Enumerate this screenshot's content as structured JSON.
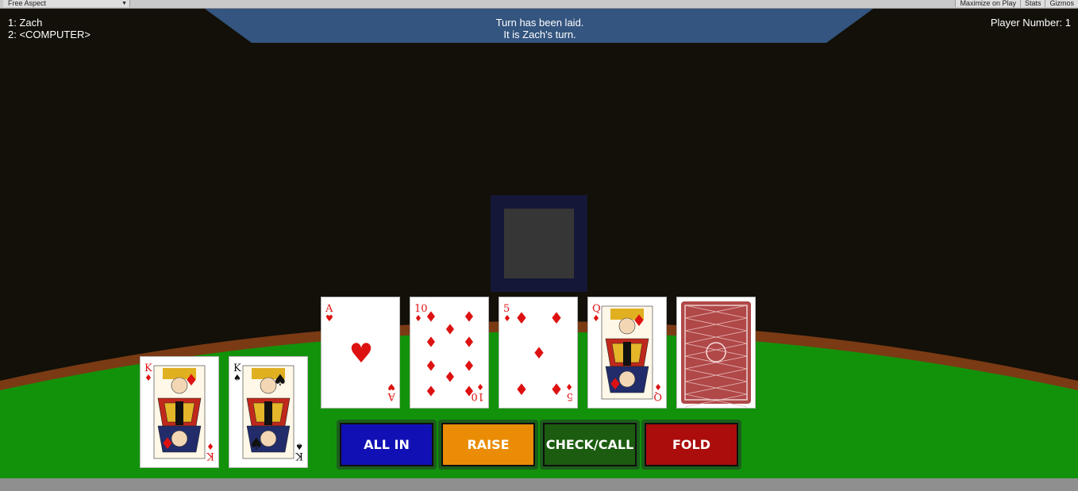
{
  "editor": {
    "aspect_label": "Free Aspect",
    "maximize_label": "Maximize on Play",
    "stats_label": "Stats",
    "gizmos_label": "Gizmos"
  },
  "status": {
    "line1": "Turn has been laid.",
    "line2": "It is Zach's turn."
  },
  "players": [
    "1: Zach",
    "2: <COMPUTER>"
  ],
  "player_number": "Player Number: 1",
  "hand": [
    {
      "rank": "K",
      "suit": "diamonds",
      "suit_symbol": "♦",
      "color": "#dd1111"
    },
    {
      "rank": "K",
      "suit": "spades",
      "suit_symbol": "♠",
      "color": "#111111"
    }
  ],
  "community": [
    {
      "rank": "A",
      "suit": "hearts",
      "suit_symbol": "♥",
      "color": "#dd1111"
    },
    {
      "rank": "10",
      "suit": "diamonds",
      "suit_symbol": "♦",
      "color": "#dd1111"
    },
    {
      "rank": "5",
      "suit": "diamonds",
      "suit_symbol": "♦",
      "color": "#dd1111"
    },
    {
      "rank": "Q",
      "suit": "diamonds",
      "suit_symbol": "♦",
      "color": "#dd1111"
    },
    {
      "rank": "",
      "suit": "",
      "face_down": true
    }
  ],
  "actions": [
    {
      "id": "all-in",
      "label": "ALL IN",
      "color": "#1010b4"
    },
    {
      "id": "raise",
      "label": "RAISE",
      "color": "#ea8c05"
    },
    {
      "id": "check-call",
      "label": "CHECK/CALL",
      "color": "#1c5c10"
    },
    {
      "id": "fold",
      "label": "FOLD",
      "color": "#ab0c0c"
    }
  ],
  "colors": {
    "felt": "#12920b",
    "rail": "#7a3a14",
    "background": "#121008",
    "banner": "#34557f",
    "card_back": "#b04848"
  }
}
